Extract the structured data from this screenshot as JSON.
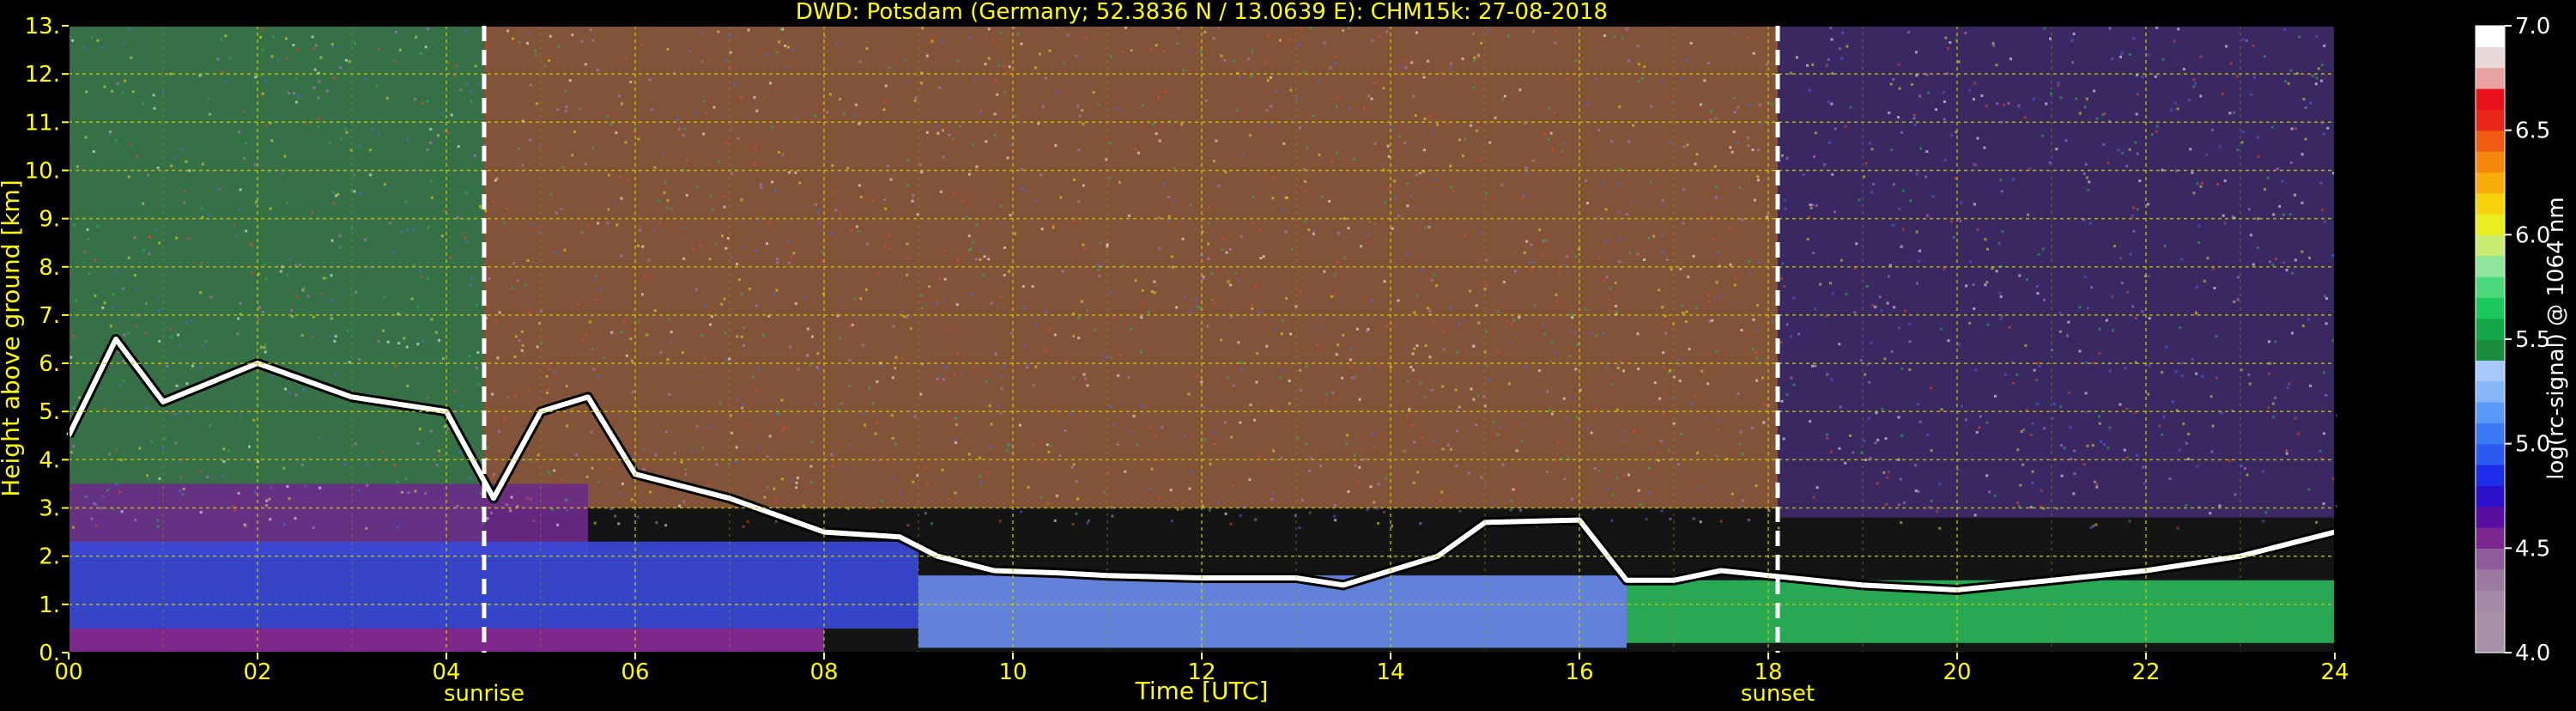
{
  "chart_data": {
    "type": "heatmap",
    "title": "DWD: Potsdam (Germany; 52.3836 N / 13.0639 E):    CHM15k: 27-08-2018",
    "xlabel": "Time [UTC]",
    "ylabel": "Height above ground [km]",
    "xlim": [
      0,
      24
    ],
    "ylim": [
      0,
      13
    ],
    "x_ticks": [
      "00",
      "02",
      "04",
      "06",
      "08",
      "10",
      "12",
      "14",
      "16",
      "18",
      "20",
      "22",
      "24"
    ],
    "y_ticks": [
      "0.",
      "1.",
      "2.",
      "3.",
      "4.",
      "5.",
      "6.",
      "7.",
      "8.",
      "9.",
      "10.",
      "11.",
      "12.",
      "13."
    ],
    "grid": true,
    "annotations": [
      {
        "label": "sunrise",
        "x": 4.4
      },
      {
        "label": "sunset",
        "x": 18.1
      }
    ],
    "colorbar": {
      "label": "log(rc-signal) @ 1064 nm",
      "range": [
        4.0,
        7.0
      ],
      "ticks": [
        "4.0",
        "4.5",
        "5.0",
        "5.5",
        "6.0",
        "6.5",
        "7.0"
      ],
      "colors": [
        "#a892a8",
        "#a890a8",
        "#a58aa8",
        "#9b7aa0",
        "#8f5a98",
        "#7a2890",
        "#5a0ea0",
        "#2a10c8",
        "#1c2ce8",
        "#2a5af0",
        "#3a78f4",
        "#5a9af6",
        "#86b6f8",
        "#a8c8fa",
        "#1a8c3c",
        "#12a84a",
        "#1cc85a",
        "#4ad87a",
        "#8ee49a",
        "#c8ec72",
        "#e8ee20",
        "#f6d20c",
        "#f8ac0a",
        "#f68810",
        "#f05a12",
        "#e8261a",
        "#e8101a",
        "#e8a0a0",
        "#e8d8d8",
        "#ffffff"
      ]
    },
    "layers": [
      {
        "name": "upper-noise-left",
        "x": [
          0,
          4.4
        ],
        "y": [
          2.3,
          13
        ],
        "color": "#3a7a4c"
      },
      {
        "name": "upper-noise-day",
        "x": [
          4.4,
          18.1
        ],
        "y": [
          3.0,
          13
        ],
        "color": "#8e5a3c"
      },
      {
        "name": "upper-noise-night",
        "x": [
          18.1,
          24
        ],
        "y": [
          2.8,
          13
        ],
        "color": "#3e2a6a"
      },
      {
        "name": "mid-purple-left",
        "x": [
          0,
          5.5
        ],
        "y": [
          2.0,
          3.5
        ],
        "color": "#6a2a8a"
      },
      {
        "name": "boundary-layer-blue",
        "x": [
          0,
          9
        ],
        "y": [
          0.5,
          2.3
        ],
        "color": "#3a4adc"
      },
      {
        "name": "boundary-layer-day",
        "x": [
          9,
          16.5
        ],
        "y": [
          0.1,
          1.6
        ],
        "color": "#6a8ef0"
      },
      {
        "name": "boundary-layer-green",
        "x": [
          16.5,
          24
        ],
        "y": [
          0.2,
          1.5
        ],
        "color": "#2ab85a"
      },
      {
        "name": "surface-purple",
        "x": [
          0,
          8
        ],
        "y": [
          0,
          0.5
        ],
        "color": "#8a2a9a"
      }
    ],
    "cloud_layer": {
      "x": [
        0,
        0.5,
        1,
        2,
        3,
        4,
        4.5,
        5,
        5.5,
        6,
        7,
        8,
        8.8,
        9.2,
        9.8,
        10.5,
        11,
        12,
        13,
        13.5,
        14,
        14.5,
        15,
        16,
        16.5,
        17,
        17.5,
        18,
        18.5,
        19,
        20,
        21,
        22,
        23,
        24
      ],
      "y": [
        4.5,
        6.5,
        5.2,
        6.0,
        5.3,
        5.0,
        3.2,
        5.0,
        5.3,
        3.7,
        3.2,
        2.5,
        2.4,
        2.0,
        1.7,
        1.65,
        1.6,
        1.55,
        1.55,
        1.4,
        1.7,
        2.0,
        2.7,
        2.75,
        1.5,
        1.5,
        1.7,
        1.6,
        1.5,
        1.4,
        1.3,
        1.5,
        1.7,
        2.0,
        2.5
      ]
    }
  }
}
